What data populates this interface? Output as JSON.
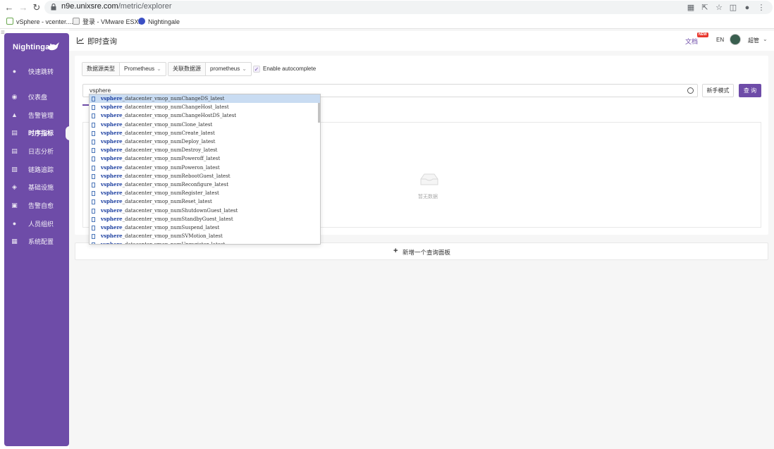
{
  "browser": {
    "url_host": "n9e.unixsre.com",
    "url_path": "/metric/explorer",
    "bookmarks": [
      {
        "label": "vSphere - vcenter...."
      },
      {
        "label": "登录 - VMware ESXi"
      },
      {
        "label": "Nightingale"
      }
    ]
  },
  "sidebar": {
    "brand": "Nightingale",
    "items": [
      {
        "label": "快速跳转",
        "icon": "search-icon"
      },
      {
        "label": "仪表盘",
        "icon": "dashboard-icon"
      },
      {
        "label": "告警管理",
        "icon": "alarm-icon"
      },
      {
        "label": "时序指标",
        "icon": "chart-icon",
        "active": true
      },
      {
        "label": "日志分析",
        "icon": "log-icon"
      },
      {
        "label": "链路追踪",
        "icon": "trace-icon"
      },
      {
        "label": "基础设施",
        "icon": "infra-icon"
      },
      {
        "label": "告警自愈",
        "icon": "self-heal-icon"
      },
      {
        "label": "人员组织",
        "icon": "user-icon"
      },
      {
        "label": "系统配置",
        "icon": "settings-icon"
      }
    ]
  },
  "header": {
    "title": "即时查询",
    "docs": "文档",
    "docs_badge": "NEW",
    "lang": "EN",
    "user": "超管"
  },
  "query": {
    "datasource_type_label": "数据源类型",
    "datasource_type_value": "Prometheus",
    "datasource_label": "关联数据源",
    "datasource_value": "prometheus",
    "autocomplete_label": "Enable autocomplete",
    "autocomplete_checked": true,
    "input_value": "vsphere",
    "beginner_mode": "新手模式",
    "query_button": "查 询",
    "empty_text": "暂无数据"
  },
  "add_panel": "新增一个查询面板",
  "autocomplete": {
    "match": "vsphere",
    "items": [
      "_datacenter_vmop_numChangeDS_latest",
      "_datacenter_vmop_numChangeHost_latest",
      "_datacenter_vmop_numChangeHostDS_latest",
      "_datacenter_vmop_numClone_latest",
      "_datacenter_vmop_numCreate_latest",
      "_datacenter_vmop_numDeploy_latest",
      "_datacenter_vmop_numDestroy_latest",
      "_datacenter_vmop_numPoweroff_latest",
      "_datacenter_vmop_numPoweron_latest",
      "_datacenter_vmop_numRebootGuest_latest",
      "_datacenter_vmop_numReconfigure_latest",
      "_datacenter_vmop_numRegister_latest",
      "_datacenter_vmop_numReset_latest",
      "_datacenter_vmop_numShutdownGuest_latest",
      "_datacenter_vmop_numStandbyGuest_latest",
      "_datacenter_vmop_numSuspend_latest",
      "_datacenter_vmop_numSVMotion_latest",
      "_datacenter_vmop_numUnregister_latest"
    ],
    "selected_index": 0
  },
  "colors": {
    "accent": "#6e4ca8",
    "highlight": "#1c3fa0",
    "selected_row": "#c9dcf2"
  }
}
